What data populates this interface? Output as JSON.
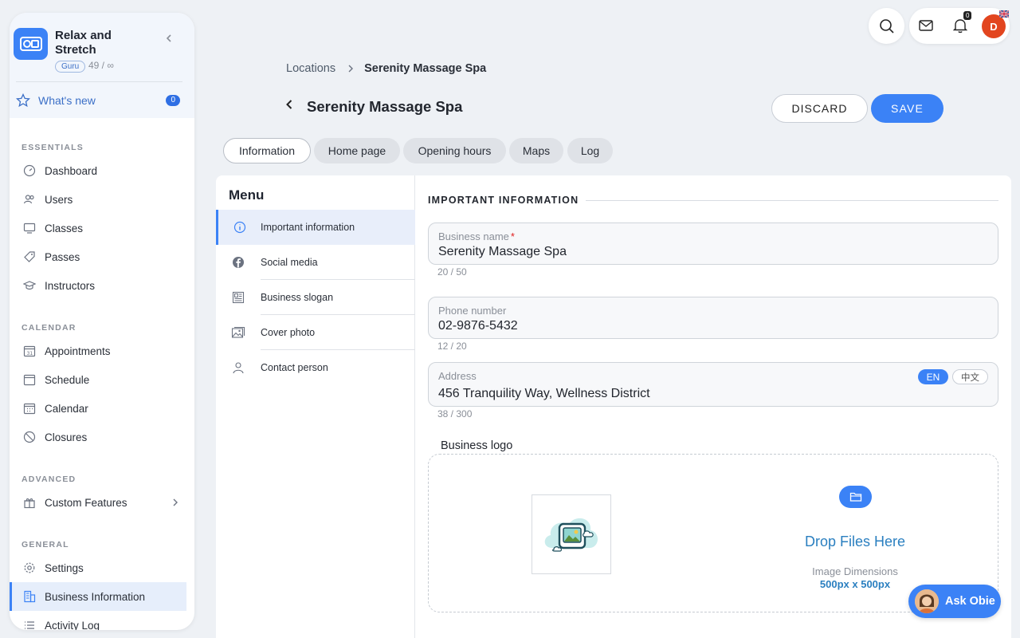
{
  "sidebar": {
    "org_name": "Relax and Stretch",
    "badge": "Guru",
    "count": "49 / ∞",
    "whats_new": {
      "label": "What's new",
      "count": "0"
    },
    "sections": [
      {
        "title": "ESSENTIALS",
        "items": [
          {
            "label": "Dashboard",
            "icon": "gauge-icon"
          },
          {
            "label": "Users",
            "icon": "users-icon"
          },
          {
            "label": "Classes",
            "icon": "monitor-icon"
          },
          {
            "label": "Passes",
            "icon": "tag-icon"
          },
          {
            "label": "Instructors",
            "icon": "graduation-cap-icon"
          }
        ]
      },
      {
        "title": "CALENDAR",
        "items": [
          {
            "label": "Appointments",
            "icon": "calendar-31-icon"
          },
          {
            "label": "Schedule",
            "icon": "calendar-icon"
          },
          {
            "label": "Calendar",
            "icon": "calendar-grid-icon"
          },
          {
            "label": "Closures",
            "icon": "prohibited-icon"
          }
        ]
      },
      {
        "title": "ADVANCED",
        "items": [
          {
            "label": "Custom Features",
            "icon": "gift-icon"
          }
        ]
      },
      {
        "title": "GENERAL",
        "items": [
          {
            "label": "Settings",
            "icon": "gear-icon"
          },
          {
            "label": "Business Information",
            "icon": "building-icon"
          },
          {
            "label": "Activity Log",
            "icon": "list-icon"
          }
        ]
      }
    ]
  },
  "topbar": {
    "notification_count": "0",
    "avatar_initial": "D"
  },
  "breadcrumb": {
    "parent": "Locations",
    "current": "Serenity Massage Spa"
  },
  "page": {
    "title": "Serenity Massage Spa",
    "discard_label": "DISCARD",
    "save_label": "SAVE"
  },
  "tabs": [
    "Information",
    "Home page",
    "Opening hours",
    "Maps",
    "Log"
  ],
  "menu": {
    "title": "Menu",
    "items": [
      {
        "label": "Important information",
        "icon": "info-icon"
      },
      {
        "label": "Social media",
        "icon": "facebook-icon"
      },
      {
        "label": "Business slogan",
        "icon": "newspaper-icon"
      },
      {
        "label": "Cover photo",
        "icon": "image-icon"
      },
      {
        "label": "Contact person",
        "icon": "person-icon"
      }
    ]
  },
  "form": {
    "section_title": "IMPORTANT INFORMATION",
    "business_name": {
      "label": "Business name",
      "required": "*",
      "value": "Serenity Massage Spa",
      "count": "20 / 50"
    },
    "phone": {
      "label": "Phone number",
      "value": "02-9876-5432",
      "count": "12 / 20"
    },
    "address": {
      "label": "Address",
      "value": "456 Tranquility Way, Wellness District",
      "count": "38 / 300",
      "lang_en": "EN",
      "lang_zh": "中文"
    },
    "logo": {
      "label": "Business logo",
      "drop_text": "Drop Files Here",
      "dimensions_label": "Image Dimensions",
      "dimensions": "500px x 500px"
    }
  },
  "ask_obie": "Ask Obie",
  "colors": {
    "accent": "#3b82f6",
    "link": "#2a7fc0",
    "avatar": "#e2451f"
  }
}
